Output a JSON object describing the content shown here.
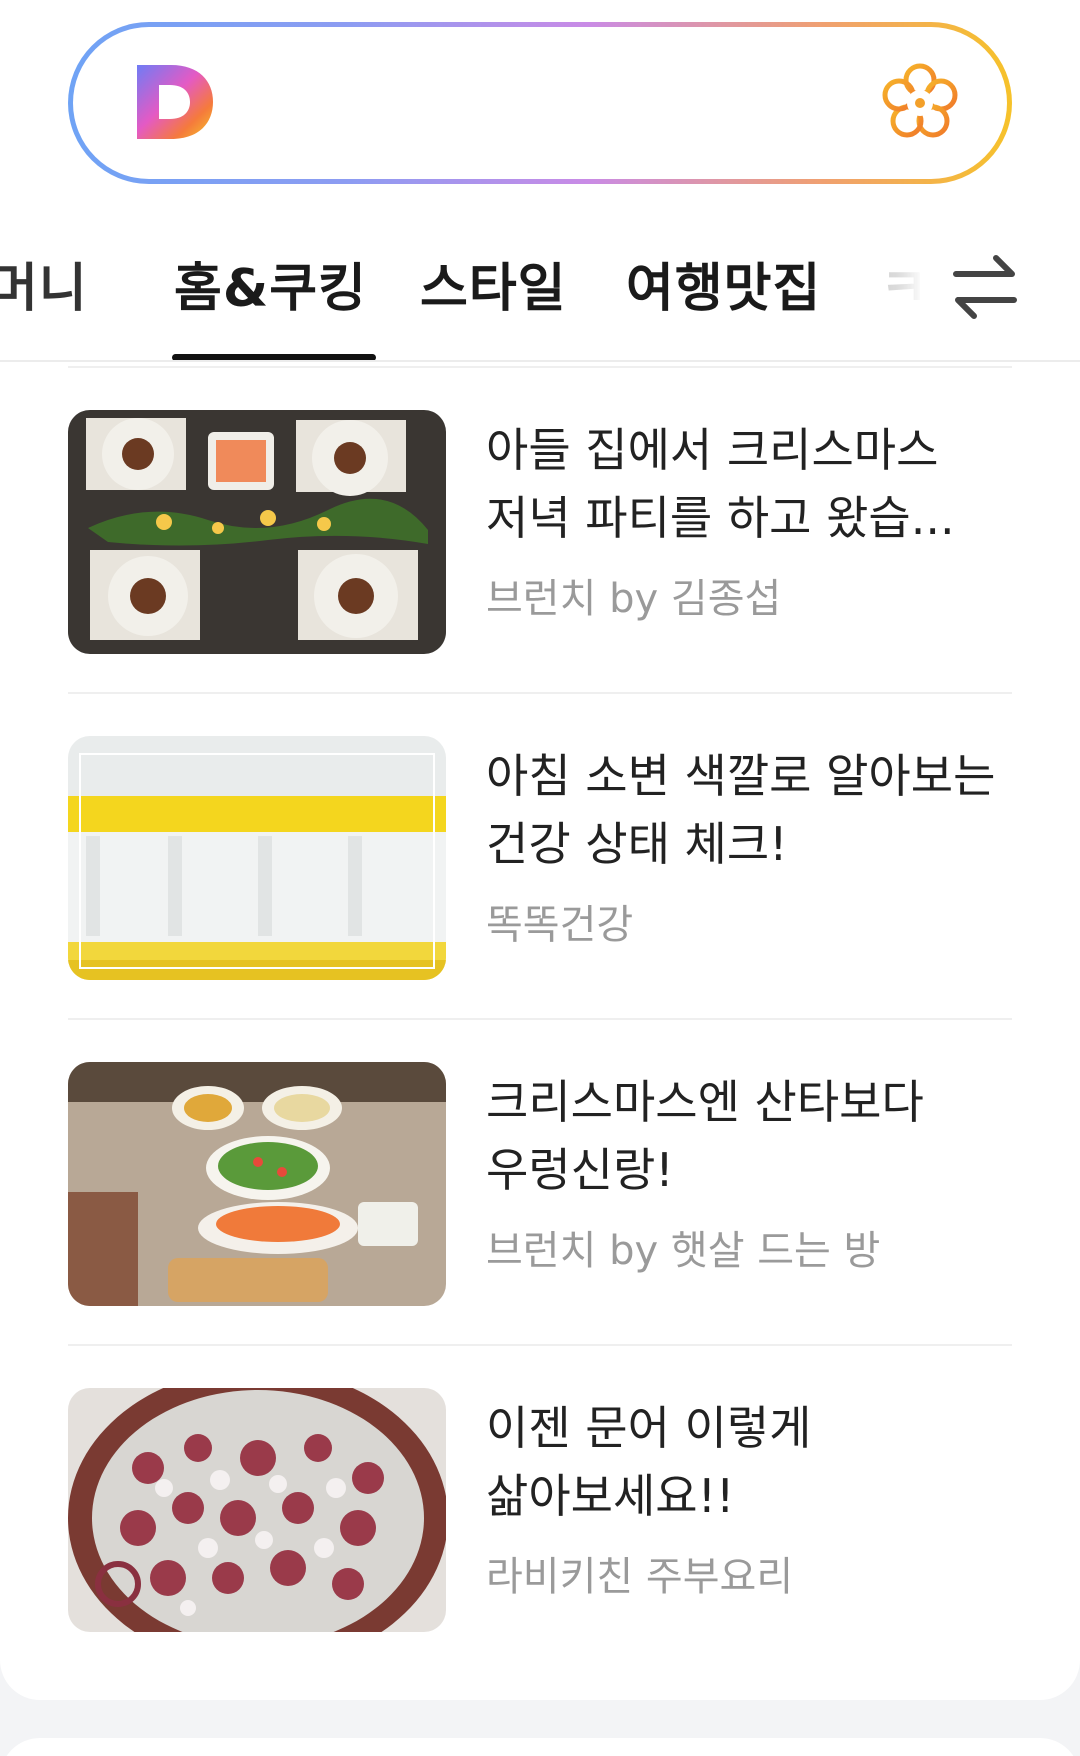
{
  "search": {
    "value": ""
  },
  "tabs": [
    {
      "label": "머니"
    },
    {
      "label": "홈&쿠킹"
    },
    {
      "label": "스타일"
    },
    {
      "label": "여행맛집"
    },
    {
      "label": "ㅋ"
    }
  ],
  "active_tab_index": 1,
  "icons": {
    "logo": "d-logo-icon",
    "flower": "flower-icon",
    "swap": "swap-arrows-icon"
  },
  "colors": {
    "gradient_start": "#6fa3f5",
    "gradient_end": "#f6c22a",
    "title_text": "#222222",
    "source_text": "#9a9a9a"
  },
  "articles": [
    {
      "title": "아들 집에서 크리스마스 저녁 파티를 하고 왔습...",
      "source": "브런치 by 김종섭",
      "image": "christmas-dinner-table"
    },
    {
      "title": "아침 소변 색깔로 알아보는 건강 상태 체크!",
      "source": "똑똑건강",
      "image": "urine-sample-cups"
    },
    {
      "title": "크리스마스엔 산타보다 우렁신랑!",
      "source": "브런치 by 햇살 드는 방",
      "image": "party-food-spread"
    },
    {
      "title": "이젠 문어 이렇게 삶아보세요!!",
      "source": "라비키친 주부요리",
      "image": "boiled-octopus-plate"
    }
  ]
}
